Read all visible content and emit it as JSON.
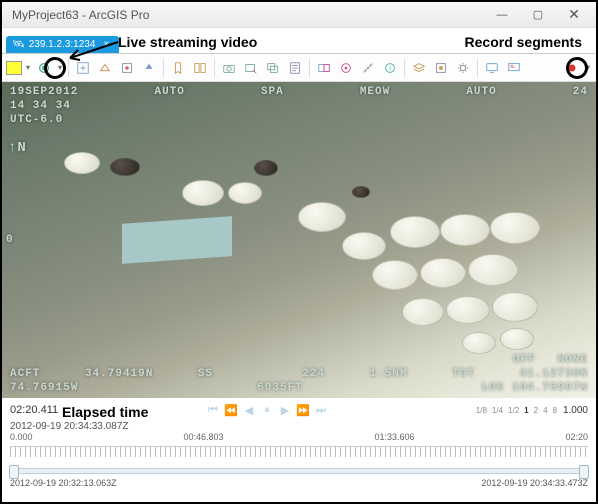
{
  "window": {
    "title": "MyProject63 - ArcGIS Pro"
  },
  "tab": {
    "label": "239.1.2.3:1234"
  },
  "annotations": {
    "live": "Live streaming video",
    "record": "Record segments",
    "elapsed": "Elapsed time"
  },
  "video_overlay": {
    "date": "19SEP2012",
    "auto1": "AUTO",
    "spa": "SPA",
    "meow": "MEOW",
    "auto2": "AUTO",
    "n24": "24",
    "time": "14 34 34",
    "utc": "UTC-6.0",
    "compass": "N",
    "acft": "ACFT",
    "tgt": "TGT",
    "sensor_lat": "34.79419N",
    "sensor_ss": "SS",
    "az": "224",
    "rng": "1.5NM",
    "tgt_lat": "41.12736N",
    "sensor_lon": "74.76915W",
    "sensor_alt_ft": "6035FT",
    "los": "LOS 104.78997W",
    "off": "OFF",
    "none": "NONE",
    "north_ind": "0"
  },
  "time": {
    "elapsed": "02:20.411",
    "utc_now": "2012-09-19 20:34:33.087Z",
    "speeds": [
      "1/8",
      "1/4",
      "1/2",
      "1",
      "2",
      "4",
      "8"
    ],
    "speed_selected": "1",
    "speed_value": "1.000",
    "ticks": [
      "0.000",
      "00:46.803",
      "01:33.606",
      "02:20"
    ],
    "range_start": "2012-09-19 20:32:13.063Z",
    "range_end": "2012-09-19 20:34:33.473Z"
  }
}
